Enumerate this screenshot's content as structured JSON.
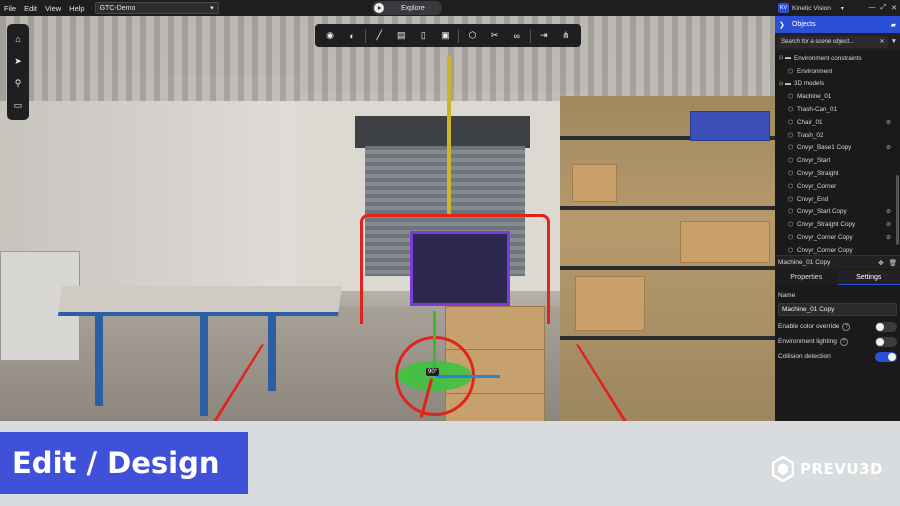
{
  "menubar": {
    "items": [
      "File",
      "Edit",
      "View",
      "Help"
    ],
    "project": "GTC-Demo",
    "mode_button": "Explore"
  },
  "account": {
    "initials": "KV",
    "name": "Kinetic Vision"
  },
  "objects_panel": {
    "title": "Objects",
    "search_placeholder": "Search for a scene object...",
    "tree": [
      {
        "label": "Environment constraints",
        "depth": 0,
        "type": "folder"
      },
      {
        "label": "Environment",
        "depth": 1,
        "type": "object"
      },
      {
        "label": "3D models",
        "depth": 0,
        "type": "folder"
      },
      {
        "label": "Machine_01",
        "depth": 1,
        "type": "object"
      },
      {
        "label": "Trash-Can_01",
        "depth": 1,
        "type": "object"
      },
      {
        "label": "Chair_01",
        "depth": 1,
        "type": "object",
        "hidden": true
      },
      {
        "label": "Trash_02",
        "depth": 1,
        "type": "object"
      },
      {
        "label": "Cnvyr_Base1 Copy",
        "depth": 1,
        "type": "object",
        "hidden": true
      },
      {
        "label": "Cnvyr_Start",
        "depth": 1,
        "type": "object"
      },
      {
        "label": "Cnvyr_Straight",
        "depth": 1,
        "type": "object"
      },
      {
        "label": "Cnvyr_Corner",
        "depth": 1,
        "type": "object"
      },
      {
        "label": "Cnvyr_End",
        "depth": 1,
        "type": "object"
      },
      {
        "label": "Cnvyr_Start Copy",
        "depth": 1,
        "type": "object",
        "hidden": true
      },
      {
        "label": "Cnvyr_Straight Copy",
        "depth": 1,
        "type": "object",
        "hidden": true
      },
      {
        "label": "Cnvyr_Corner Copy",
        "depth": 1,
        "type": "object",
        "hidden": true
      },
      {
        "label": "Cnvyr_Corner Copy",
        "depth": 1,
        "type": "object"
      }
    ]
  },
  "selection": {
    "name": "Machine_01 Copy"
  },
  "tabs": {
    "properties": "Properties",
    "settings": "Settings"
  },
  "settings": {
    "name_label": "Name",
    "name_value": "Machine_01 Copy",
    "rows": [
      {
        "label": "Enable color override",
        "on": false
      },
      {
        "label": "Environment lighting",
        "on": false
      },
      {
        "label": "Collision detection",
        "on": true
      }
    ]
  },
  "gizmo": {
    "angle_label": "90°"
  },
  "banner": {
    "caption": "Edit / Design",
    "brand": "PREVU3D"
  },
  "colors": {
    "accent": "#2c4fd7",
    "caption_bg": "#3f51d8",
    "selection_outline": "#e0241b",
    "banner_bg": "#d9dcdf"
  }
}
